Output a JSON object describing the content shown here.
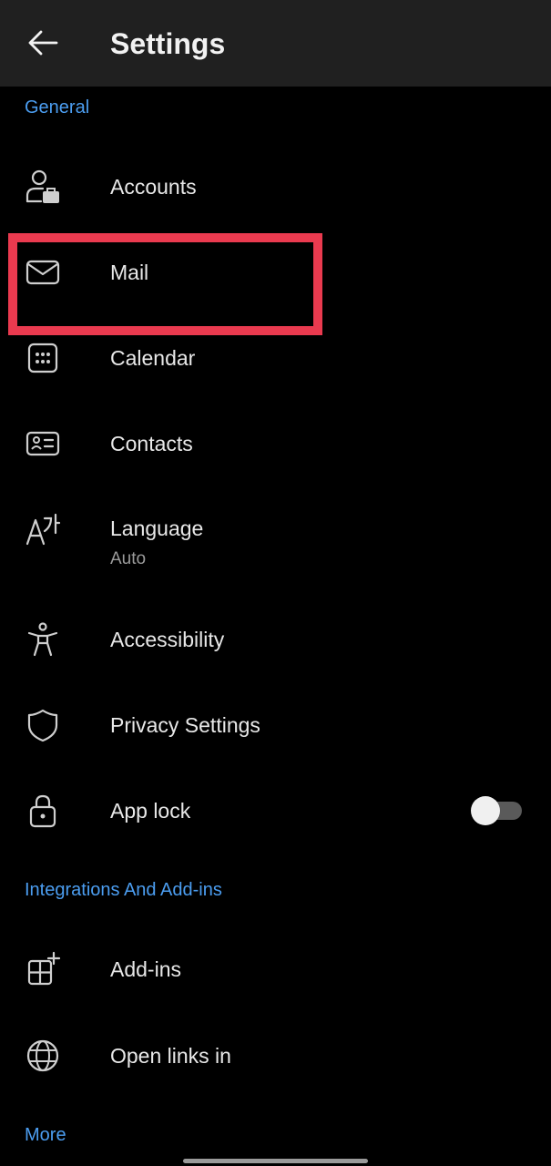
{
  "header": {
    "title": "Settings",
    "back_icon": "arrow-left-icon"
  },
  "sections": {
    "general": "General",
    "integrations": "Integrations And Add-ins",
    "more": "More"
  },
  "general_items": [
    {
      "label": "Accounts",
      "icon": "account-briefcase-icon"
    },
    {
      "label": "Mail",
      "icon": "envelope-icon"
    },
    {
      "label": "Calendar",
      "icon": "calendar-icon"
    },
    {
      "label": "Contacts",
      "icon": "contact-card-icon"
    },
    {
      "label": "Language",
      "sublabel": "Auto",
      "icon": "language-icon"
    },
    {
      "label": "Accessibility",
      "icon": "accessibility-icon"
    },
    {
      "label": "Privacy Settings",
      "icon": "shield-icon"
    },
    {
      "label": "App lock",
      "icon": "lock-icon",
      "toggle_on": false
    }
  ],
  "integration_items": [
    {
      "label": "Add-ins",
      "icon": "add-ins-icon"
    },
    {
      "label": "Open links in",
      "icon": "globe-icon"
    }
  ],
  "colors": {
    "accent": "#4b9df0",
    "highlight": "#ea3a4f",
    "header_bg": "#202020",
    "background": "#000000"
  }
}
